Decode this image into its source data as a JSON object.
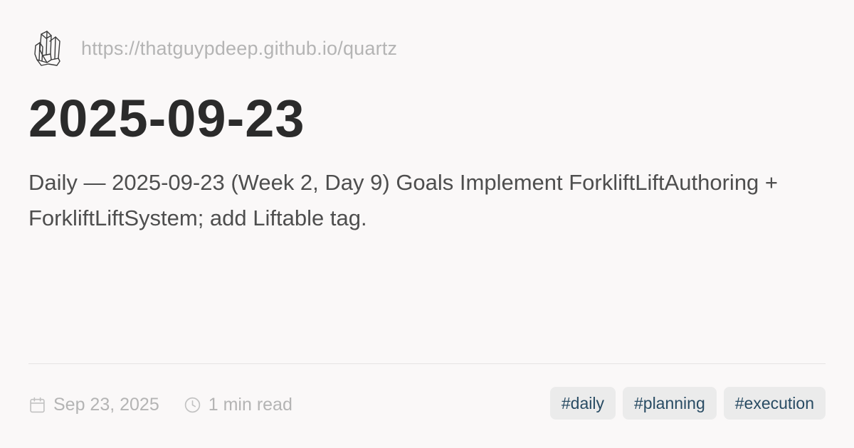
{
  "site": {
    "logo_icon": "crystal-icon",
    "url": "https://thatguypdeep.github.io/quartz"
  },
  "page": {
    "title": "2025-09-23",
    "description": "Daily — 2025-09-23 (Week 2, Day 9) Goals Implement ForkliftLiftAuthoring + ForkliftLiftSystem; add Liftable tag."
  },
  "meta": {
    "date_icon": "calendar-icon",
    "date": "Sep 23, 2025",
    "reading_time_icon": "clock-icon",
    "reading_time": "1 min read"
  },
  "tags": [
    "#daily",
    "#planning",
    "#execution"
  ],
  "colors": {
    "background": "#faf8f8",
    "title": "#2b2b2b",
    "body_text": "#4e4e4e",
    "muted_text": "#b4b4b4",
    "tag_background": "#ebebeb",
    "tag_text": "#284b63"
  }
}
